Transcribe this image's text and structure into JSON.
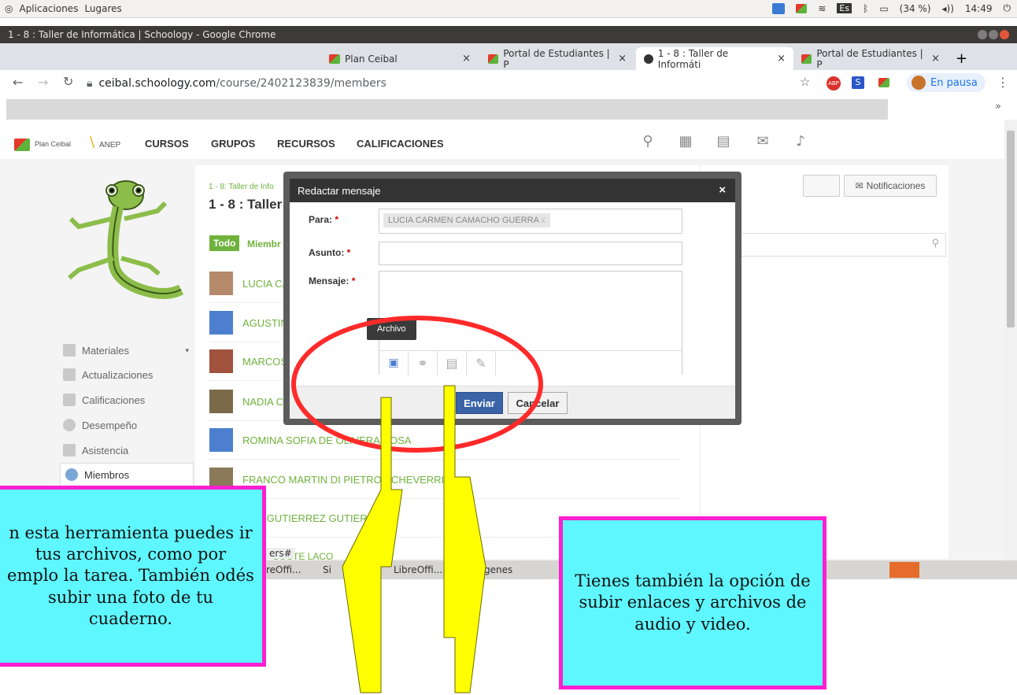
{
  "os_bar": {
    "apps": "Aplicaciones",
    "places": "Lugares",
    "keyboard": "Es",
    "battery": "(34 %)",
    "clock": "14:49"
  },
  "window": {
    "title": "1 - 8 : Taller de Informática | Schoology - Google Chrome"
  },
  "tabs": [
    {
      "label": "Plan Ceibal",
      "close": "×"
    },
    {
      "label": "Portal de Estudiantes | P",
      "close": "×"
    },
    {
      "label": "1 - 8 : Taller de Informáti",
      "close": "×"
    },
    {
      "label": "Portal de Estudiantes | P",
      "close": "×"
    }
  ],
  "new_tab": "+",
  "address": {
    "host": "ceibal.schoology.com",
    "path": "/course/2402123839/members"
  },
  "profile": {
    "label": "En pausa"
  },
  "bookmarks_more": "»",
  "site": {
    "brand": "Plan Ceibal",
    "brand2": "ANEP",
    "nav": [
      "CURSOS",
      "GRUPOS",
      "RECURSOS",
      "CALIFICACIONES"
    ],
    "breadcrumb": "1 - 8: Taller de Info",
    "course_title": "1 - 8 : Taller d",
    "filter_all": "Todo",
    "filter_members": "Miembr",
    "notifications": "Notificaciones",
    "sidebar": [
      "Materiales",
      "Actualizaciones",
      "Calificaciones",
      "Desempeño",
      "Asistencia",
      "Miembros"
    ],
    "members": [
      {
        "name": "LUCIA CA"
      },
      {
        "name": "AGUSTIN"
      },
      {
        "name": "MARCOS"
      },
      {
        "name": "NADIA CA"
      },
      {
        "name": "ROMINA SOFIA DE OLIVERA ROSA"
      },
      {
        "name": "FRANCO MARTIN DI PIETRO ECHEVERRIA"
      },
      {
        "name": "LA GUTIERREZ GUTIERR"
      },
      {
        "name": "COSTE LACO"
      }
    ]
  },
  "modal": {
    "title": "Redactar mensaje",
    "close": "×",
    "to_label": "Para:",
    "to_value": "LUCIA CARMEN CAMACHO GUERRA",
    "to_remove": "x",
    "subject_label": "Asunto:",
    "message_label": "Mensaje:",
    "required": "*",
    "tooltip": "Archivo",
    "send": "Enviar",
    "cancel": "Cancelar"
  },
  "taskbar": {
    "item1": "reOffi...",
    "item2": "Si",
    "item3": "LibreOffi...",
    "item4": "mágenes",
    "item0": "ers#"
  },
  "notes": {
    "left": "n esta herramienta puedes ir tus archivos, como por emplo la tarea. También odés subir una foto de tu cuaderno.",
    "right": "Tienes también la opción de subir enlaces y archivos de audio y video."
  },
  "colors": {
    "accent_green": "#6fb23c",
    "note_fill": "#5ef7ff",
    "note_border": "#ff1fd0",
    "highlight_circle": "#ff2a2a",
    "arrow_fill": "#ffff00",
    "send_button": "#3a63a8"
  }
}
